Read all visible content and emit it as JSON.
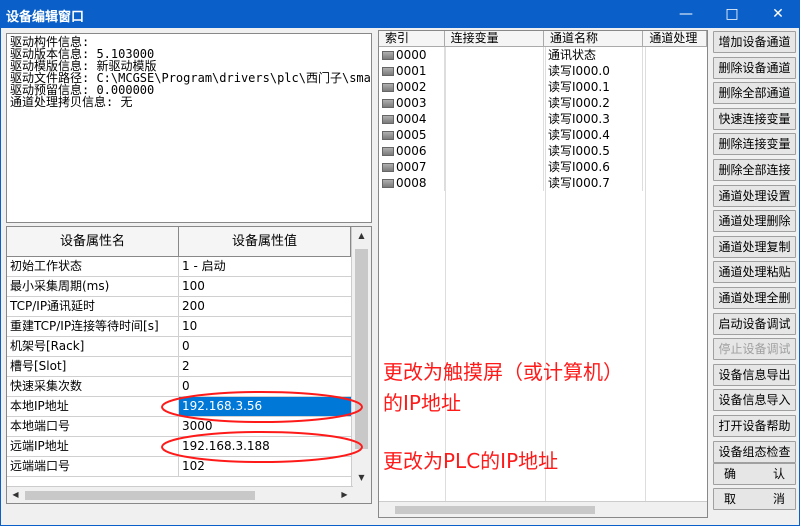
{
  "window": {
    "title": "设备编辑窗口",
    "minimize_glyph": "—",
    "maximize_glyph": "□",
    "close_glyph": "✕"
  },
  "info_panel": {
    "lines": [
      "驱动构件信息:",
      "驱动版本信息: 5.103000",
      "驱动模版信息: 新驱动模版",
      "驱动文件路径: C:\\MCGSE\\Program\\drivers\\plc\\西门子\\smart",
      "驱动预留信息: 0.000000",
      "通道处理拷贝信息: 无"
    ]
  },
  "properties": {
    "headers": [
      "设备属性名",
      "设备属性值"
    ],
    "rows": [
      {
        "name": "初始工作状态",
        "value": "1 - 启动"
      },
      {
        "name": "最小采集周期(ms)",
        "value": "100"
      },
      {
        "name": "TCP/IP通讯延时",
        "value": "200"
      },
      {
        "name": "重建TCP/IP连接等待时间[s]",
        "value": "10"
      },
      {
        "name": "机架号[Rack]",
        "value": "0"
      },
      {
        "name": "槽号[Slot]",
        "value": "2"
      },
      {
        "name": "快速采集次数",
        "value": "0"
      },
      {
        "name": "本地IP地址",
        "value": "192.168.3.56"
      },
      {
        "name": "本地端口号",
        "value": "3000"
      },
      {
        "name": "远端IP地址",
        "value": "192.168.3.188"
      },
      {
        "name": "远端端口号",
        "value": "102"
      }
    ],
    "selected_index": 7
  },
  "channels": {
    "headers": [
      "索引",
      "连接变量",
      "通道名称",
      "通道处理"
    ],
    "rows": [
      {
        "index": "0000",
        "var": "",
        "name": "通讯状态",
        "proc": ""
      },
      {
        "index": "0001",
        "var": "",
        "name": "读写I000.0",
        "proc": ""
      },
      {
        "index": "0002",
        "var": "",
        "name": "读写I000.1",
        "proc": ""
      },
      {
        "index": "0003",
        "var": "",
        "name": "读写I000.2",
        "proc": ""
      },
      {
        "index": "0004",
        "var": "",
        "name": "读写I000.3",
        "proc": ""
      },
      {
        "index": "0005",
        "var": "",
        "name": "读写I000.4",
        "proc": ""
      },
      {
        "index": "0006",
        "var": "",
        "name": "读写I000.5",
        "proc": ""
      },
      {
        "index": "0007",
        "var": "",
        "name": "读写I000.6",
        "proc": ""
      },
      {
        "index": "0008",
        "var": "",
        "name": "读写I000.7",
        "proc": ""
      }
    ]
  },
  "buttons": [
    {
      "label": "增加设备通道",
      "enabled": true
    },
    {
      "label": "删除设备通道",
      "enabled": true
    },
    {
      "label": "删除全部通道",
      "enabled": true
    },
    {
      "label": "快速连接变量",
      "enabled": true
    },
    {
      "label": "删除连接变量",
      "enabled": true
    },
    {
      "label": "删除全部连接",
      "enabled": true
    },
    {
      "label": "通道处理设置",
      "enabled": true
    },
    {
      "label": "通道处理删除",
      "enabled": true
    },
    {
      "label": "通道处理复制",
      "enabled": true
    },
    {
      "label": "通道处理粘贴",
      "enabled": true
    },
    {
      "label": "通道处理全删",
      "enabled": true
    },
    {
      "label": "启动设备调试",
      "enabled": true
    },
    {
      "label": "停止设备调试",
      "enabled": false
    },
    {
      "label": "设备信息导出",
      "enabled": true
    },
    {
      "label": "设备信息导入",
      "enabled": true
    },
    {
      "label": "打开设备帮助",
      "enabled": true
    },
    {
      "label": "设备组态检查",
      "enabled": true
    }
  ],
  "confirm_button": {
    "left": "确",
    "right": "认"
  },
  "cancel_button": {
    "left": "取",
    "right": "消"
  },
  "annotations": {
    "local_ip_note_line1": "更改为触摸屏（或计算机）",
    "local_ip_note_line2": "的IP地址",
    "remote_ip_note": "更改为PLC的IP地址",
    "color": "#ff1a1a"
  },
  "colors": {
    "titlebar": "#0a60c8",
    "selection": "#0078d7",
    "annotation": "#ff1a1a"
  }
}
